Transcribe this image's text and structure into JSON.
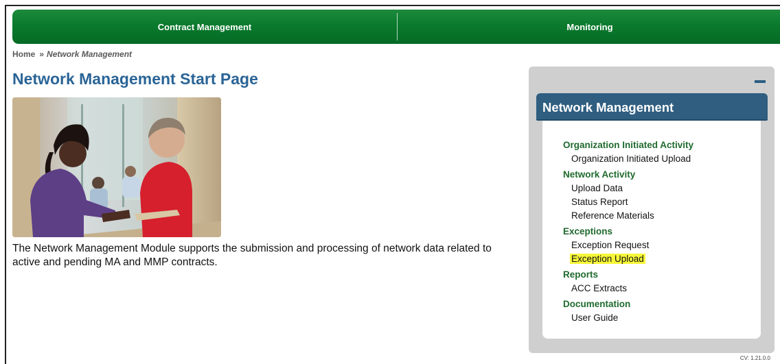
{
  "topnav": {
    "tabs": [
      {
        "label": "Contract Management"
      },
      {
        "label": "Monitoring"
      }
    ]
  },
  "breadcrumb": {
    "home": "Home",
    "separator": "»",
    "current": "Network Management"
  },
  "page": {
    "title": "Network Management Start Page",
    "intro": "The Network Management Module supports the submission and processing of network data related to active and pending MA and MMP contracts."
  },
  "side_panel": {
    "collapse_symbol": "–",
    "title": "Network Management",
    "sections": [
      {
        "label": "Organization Initiated Activity",
        "items": [
          {
            "label": "Organization Initiated Upload"
          }
        ]
      },
      {
        "label": "Network Activity",
        "items": [
          {
            "label": "Upload Data"
          },
          {
            "label": "Status Report"
          },
          {
            "label": "Reference Materials"
          }
        ]
      },
      {
        "label": "Exceptions",
        "items": [
          {
            "label": "Exception Request"
          },
          {
            "label": "Exception Upload",
            "highlighted": true
          }
        ]
      },
      {
        "label": "Reports",
        "items": [
          {
            "label": "ACC Extracts"
          }
        ]
      },
      {
        "label": "Documentation",
        "items": [
          {
            "label": "User Guide"
          }
        ]
      }
    ]
  },
  "footer": {
    "version": "CV: 1.21.0.0"
  },
  "colors": {
    "nav_green": "#0a7a2d",
    "title_blue": "#2a6496",
    "panel_head": "#2f5e80",
    "section_green": "#1f6a2e",
    "highlight": "#f7f73a"
  }
}
